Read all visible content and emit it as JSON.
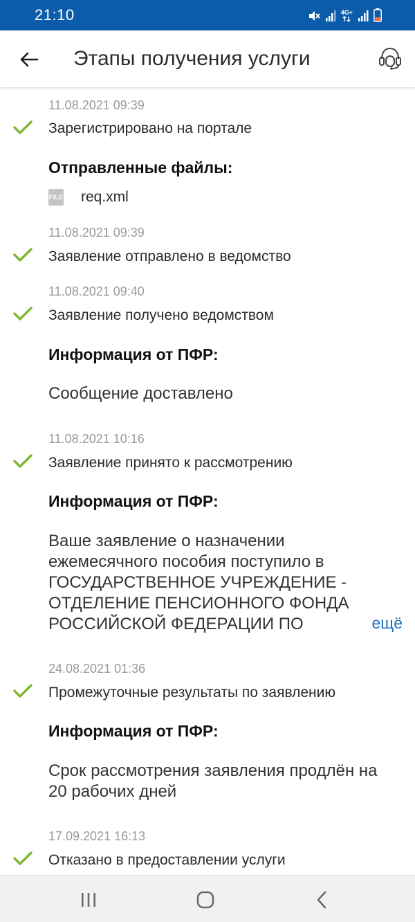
{
  "status_bar": {
    "time": "21:10",
    "network_label": "4G+",
    "colors": {
      "background": "#0b5cab",
      "battery_low": "#ff6b3d"
    }
  },
  "header": {
    "title": "Этапы получения услуги",
    "back_icon": "arrow-left-icon",
    "support_icon": "headset-icon"
  },
  "steps": [
    {
      "date": "11.08.2021 09:39",
      "status": "Зарегистрировано на портале",
      "section_heading": "Отправленные файлы:",
      "file": {
        "icon_label": "FILE",
        "name": "req.xml"
      }
    },
    {
      "date": "11.08.2021 09:39",
      "status": "Заявление отправлено в ведомство"
    },
    {
      "date": "11.08.2021 09:40",
      "status": "Заявление получено ведомством",
      "section_heading": "Информация от ПФР:",
      "info": "Сообщение доставлено"
    },
    {
      "date": "11.08.2021 10:16",
      "status": "Заявление принято к рассмотрению",
      "section_heading": "Информация от ПФР:",
      "info": "Ваше заявление о назначении ежемесячного пособия поступило в ГОСУДАРСТВЕННОЕ УЧРЕЖДЕНИЕ - ОТДЕЛЕНИЕ ПЕНСИОННОГО ФОНДА РОССИЙСКОЙ ФЕДЕРАЦИИ ПО",
      "more_label": "ещё"
    },
    {
      "date": "24.08.2021 01:36",
      "status": "Промежуточные результаты по заявлению",
      "section_heading": "Информация от ПФР:",
      "info": "Срок рассмотрения заявления продлён на 20 рабочих дней"
    },
    {
      "date": "17.09.2021 16:13",
      "status": "Отказано в предоставлении услуги"
    }
  ],
  "theme": {
    "check_color": "#7cb82f",
    "link_color": "#1b6fc2",
    "date_color": "#9a9a9a"
  },
  "nav_bar": {
    "recents_icon": "recents-icon",
    "home_icon": "home-icon",
    "back_icon": "nav-back-icon"
  }
}
